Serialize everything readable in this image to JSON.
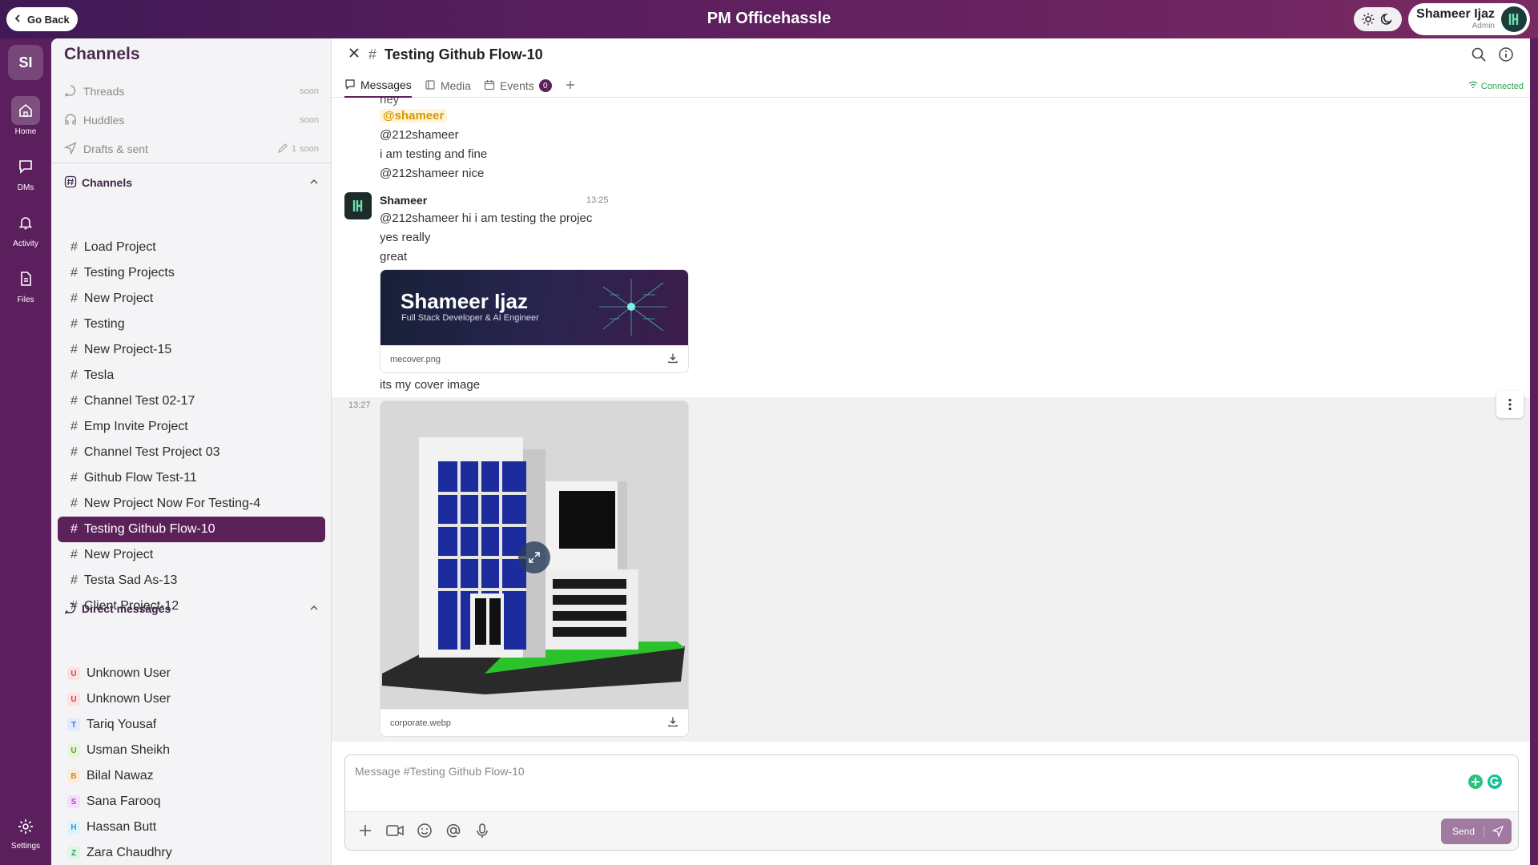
{
  "topbar": {
    "go_back": "Go Back",
    "title": "PM Officehassle",
    "user_name": "Shameer Ijaz",
    "user_role": "Admin"
  },
  "workspace": {
    "badge": "SI"
  },
  "rail": [
    {
      "label": "Home",
      "icon": "home-icon",
      "active": true
    },
    {
      "label": "DMs",
      "icon": "chat-icon",
      "active": false
    },
    {
      "label": "Activity",
      "icon": "bell-icon",
      "active": false
    },
    {
      "label": "Files",
      "icon": "file-icon",
      "active": false
    }
  ],
  "rail_settings": "Settings",
  "sidebar": {
    "title": "Channels",
    "quick": [
      {
        "label": "Threads",
        "badge": "soon"
      },
      {
        "label": "Huddles",
        "badge": "soon"
      },
      {
        "label": "Drafts & sent",
        "count": "1",
        "badge": "soon"
      }
    ],
    "channels_heading": "Channels",
    "channels": [
      "Load Project",
      "Testing Projects",
      "New Project",
      "Testing",
      "New Project-15",
      "Tesla",
      "Channel Test 02-17",
      "Emp Invite Project",
      "Channel Test Project 03",
      "Github Flow Test-11",
      "New Project Now For Testing-4",
      "Testing Github Flow-10",
      "New Project",
      "Testa Sad As-13",
      "Client Project-12"
    ],
    "active_channel_index": 11,
    "dm_heading": "Direct messages",
    "dms": [
      {
        "initial": "U",
        "name": "Unknown User",
        "bg": "#fde0e0",
        "fg": "#d14a4a"
      },
      {
        "initial": "U",
        "name": "Unknown User",
        "bg": "#fde0e0",
        "fg": "#d14a4a"
      },
      {
        "initial": "T",
        "name": "Tariq Yousaf",
        "bg": "#e2ebfb",
        "fg": "#4a6fd1"
      },
      {
        "initial": "U",
        "name": "Usman Sheikh",
        "bg": "#e4f6d8",
        "fg": "#5aa02c"
      },
      {
        "initial": "B",
        "name": "Bilal Nawaz",
        "bg": "#fdebd5",
        "fg": "#d4862a"
      },
      {
        "initial": "S",
        "name": "Sana Farooq",
        "bg": "#f6defb",
        "fg": "#b14ac7"
      },
      {
        "initial": "H",
        "name": "Hassan Butt",
        "bg": "#dcf3fb",
        "fg": "#2a9fc7"
      },
      {
        "initial": "Z",
        "name": "Zara Chaudhry",
        "bg": "#dcf5e6",
        "fg": "#2aa060"
      }
    ]
  },
  "channel": {
    "name": "Testing Github Flow-10",
    "tabs": {
      "messages": "Messages",
      "media": "Media",
      "events": "Events",
      "events_count": "0"
    },
    "status": "Connected"
  },
  "messages": {
    "partial_top": "hey",
    "mention": "@shameer",
    "lines_prev": [
      "@212shameer",
      "i am testing and fine",
      "@212shameer nice"
    ],
    "author": "Shameer",
    "author_initials": "IJ",
    "time1": "13:25",
    "lines": [
      "@212shameer hi i am testing the projec",
      "yes really",
      "great"
    ],
    "cover": {
      "name": "Shameer Ijaz",
      "subtitle": "Full Stack Developer & AI Engineer",
      "filename": "mecover.png"
    },
    "after_cover": "its my cover image",
    "time2": "13:27",
    "image2_filename": "corporate.webp"
  },
  "composer": {
    "placeholder": "Message #Testing Github Flow-10",
    "send": "Send"
  }
}
